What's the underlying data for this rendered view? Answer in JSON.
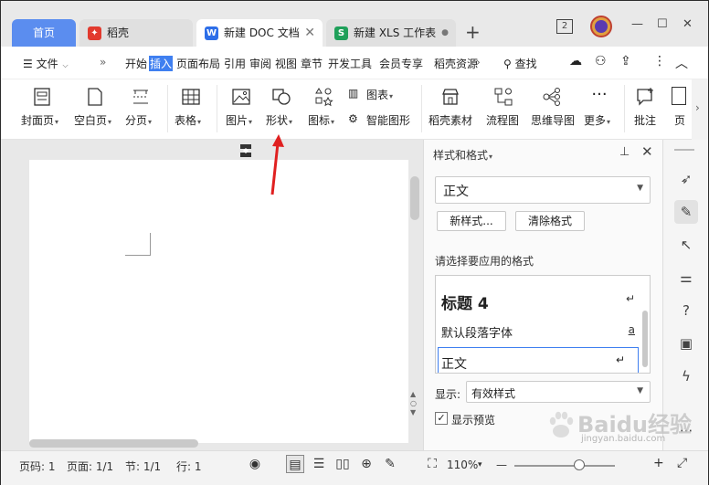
{
  "tabs": {
    "home": "首页",
    "daoke": "稻壳",
    "doc": "新建 DOC 文档",
    "xls": "新建 XLS 工作表",
    "new_tab": "+",
    "badge_count": "2"
  },
  "menu": {
    "file": "文件",
    "items": [
      "开始",
      "插入",
      "页面布局",
      "引用",
      "审阅",
      "视图",
      "章节",
      "开发工具",
      "会员专享",
      "稻壳资源"
    ],
    "active": "插入",
    "search": "查找"
  },
  "ribbon": {
    "cover": "封面页",
    "blank": "空白页",
    "pagebreak": "分页",
    "table": "表格",
    "image": "图片",
    "shape": "形状",
    "icon": "图标",
    "chart": "图表",
    "smartart": "智能图形",
    "daoke_material": "稻壳素材",
    "flowchart": "流程图",
    "mindmap": "思维导图",
    "more": "更多",
    "comment": "批注",
    "page": "页"
  },
  "panel": {
    "title": "样式和格式",
    "current_style": "正文",
    "new_style": "新样式...",
    "clear_format": "清除格式",
    "choose_label": "请选择要应用的格式",
    "styles": [
      {
        "name": "标题 4",
        "icon": "↵"
      },
      {
        "name": "默认段落字体",
        "icon": "a"
      },
      {
        "name": "正文",
        "icon": "↵"
      }
    ],
    "show_label": "显示:",
    "show_value": "有效样式",
    "preview_label": "显示预览",
    "preview_checked": true
  },
  "status": {
    "page_code": "页码: 1",
    "page": "页面: 1/1",
    "section": "节: 1/1",
    "row": "行: 1",
    "zoom": "110%"
  },
  "watermark": {
    "text": "Baidu经验",
    "url": "jingyan.baidu.com"
  },
  "colors": {
    "accent": "#3f7ff0",
    "home_tab": "#5b8def",
    "arrow": "#e02020"
  }
}
